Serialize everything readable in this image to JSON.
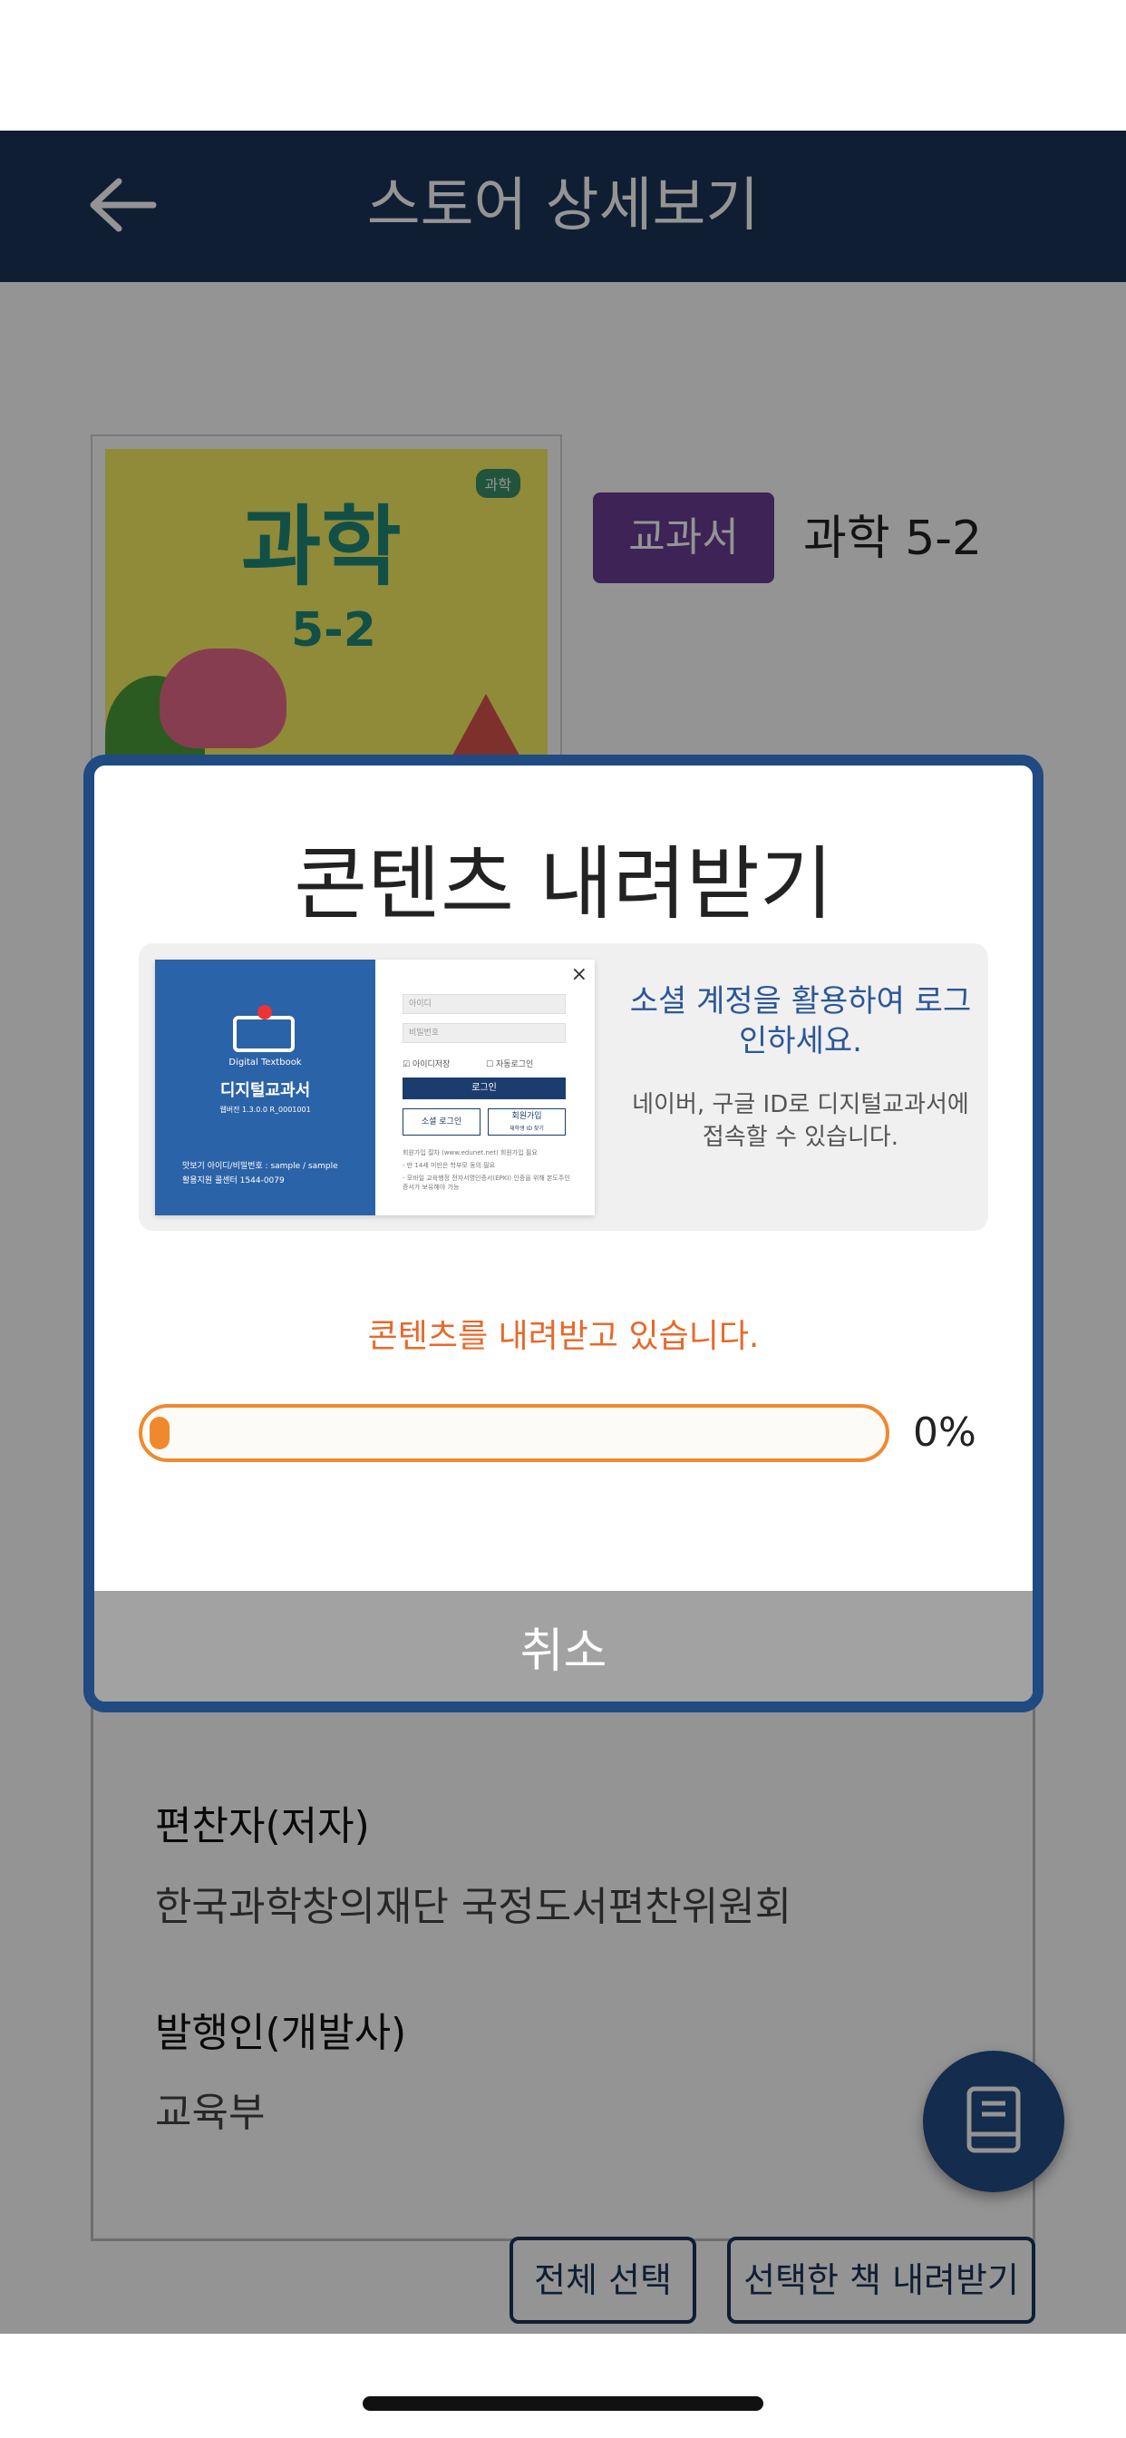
{
  "header": {
    "title": "스토어 상세보기",
    "back_icon": "arrow-left-icon"
  },
  "book": {
    "cover_title": "과학",
    "cover_subtitle": "5-2",
    "cover_tag": "과학",
    "badge": "교과서",
    "name": "과학 5-2"
  },
  "info": [
    {
      "label": "편찬자(저자)",
      "value": "한국과학창의재단 국정도서편찬위원회"
    },
    {
      "label": "발행인(개발사)",
      "value": "교육부"
    }
  ],
  "actions": {
    "select_all": "전체 선택",
    "download_selected": "선택한 책 내려받기"
  },
  "modal": {
    "title": "콘텐츠 내려받기",
    "preview": {
      "app_small": "Digital Textbook",
      "app_name": "디지털교과서",
      "app_url": "웹버전 1.3.0.0 R_0001001",
      "footer_1": "맛보기 아이디/비밀번호 : sample / sample",
      "footer_2": "활용지원 콜센터 1544-0079",
      "field_id": "아이디",
      "field_pw": "비밀번호",
      "check_save_id": "아이디저장",
      "check_auto_login": "자동로그인",
      "login_button": "로그인",
      "social_login_button": "소셜 로그인",
      "signup_button": "회원가입",
      "signup_sub": "재학생 ID 찾기",
      "note_1": "회원가입 절차 (www.edunet.net) 회원가입 필요",
      "note_2": "- 만 14세 미만은 학부모 동의 필요",
      "note_3": "- 모바일 교육행정 전자서명인증서(EPKI) 인증을 위해 본도주인증서가 보유해야 가능",
      "close_symbol": "×",
      "promo_title": "소셜 계정을 활용하여 로그인하세요.",
      "promo_desc": "네이버, 구글 ID로 디지털교과서에 접속할 수 있습니다."
    },
    "status": "콘텐츠를 내려받고 있습니다.",
    "progress_percent": 0,
    "progress_label": "0%",
    "cancel": "취소"
  },
  "fab": {
    "icon": "book-icon"
  },
  "colors": {
    "header_bg": "#1b3458",
    "badge_bg": "#6a3d95",
    "modal_border": "#1f4b82",
    "progress": "#f0892e",
    "status_text": "#e8682a",
    "cancel_bg": "#a2a2a2"
  }
}
